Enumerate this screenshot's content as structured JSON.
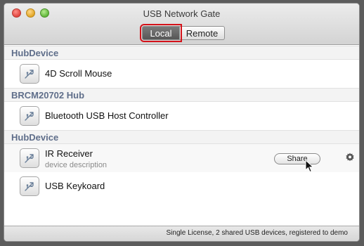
{
  "window": {
    "title": "USB Network Gate"
  },
  "tabs": {
    "local": "Local",
    "remote": "Remote",
    "selected": "Local"
  },
  "colors": {
    "group_header": "#5f6e8a",
    "highlight_outline": "#d4121a"
  },
  "groups": [
    {
      "name": "HubDevice",
      "devices": [
        {
          "name": "4D Scroll Mouse",
          "icon": "usb-icon"
        }
      ]
    },
    {
      "name": "BRCM20702 Hub",
      "devices": [
        {
          "name": "Bluetooth USB Host Controller",
          "icon": "usb-icon"
        }
      ]
    },
    {
      "name": "HubDevice",
      "devices": [
        {
          "name": "IR Receiver",
          "description": "device description",
          "action": "Share",
          "icon": "usb-icon"
        },
        {
          "name": "USB Keykoard",
          "icon": "usb-icon"
        }
      ]
    }
  ],
  "status": {
    "text": "Single License, 2 shared USB devices, registered to demo"
  }
}
